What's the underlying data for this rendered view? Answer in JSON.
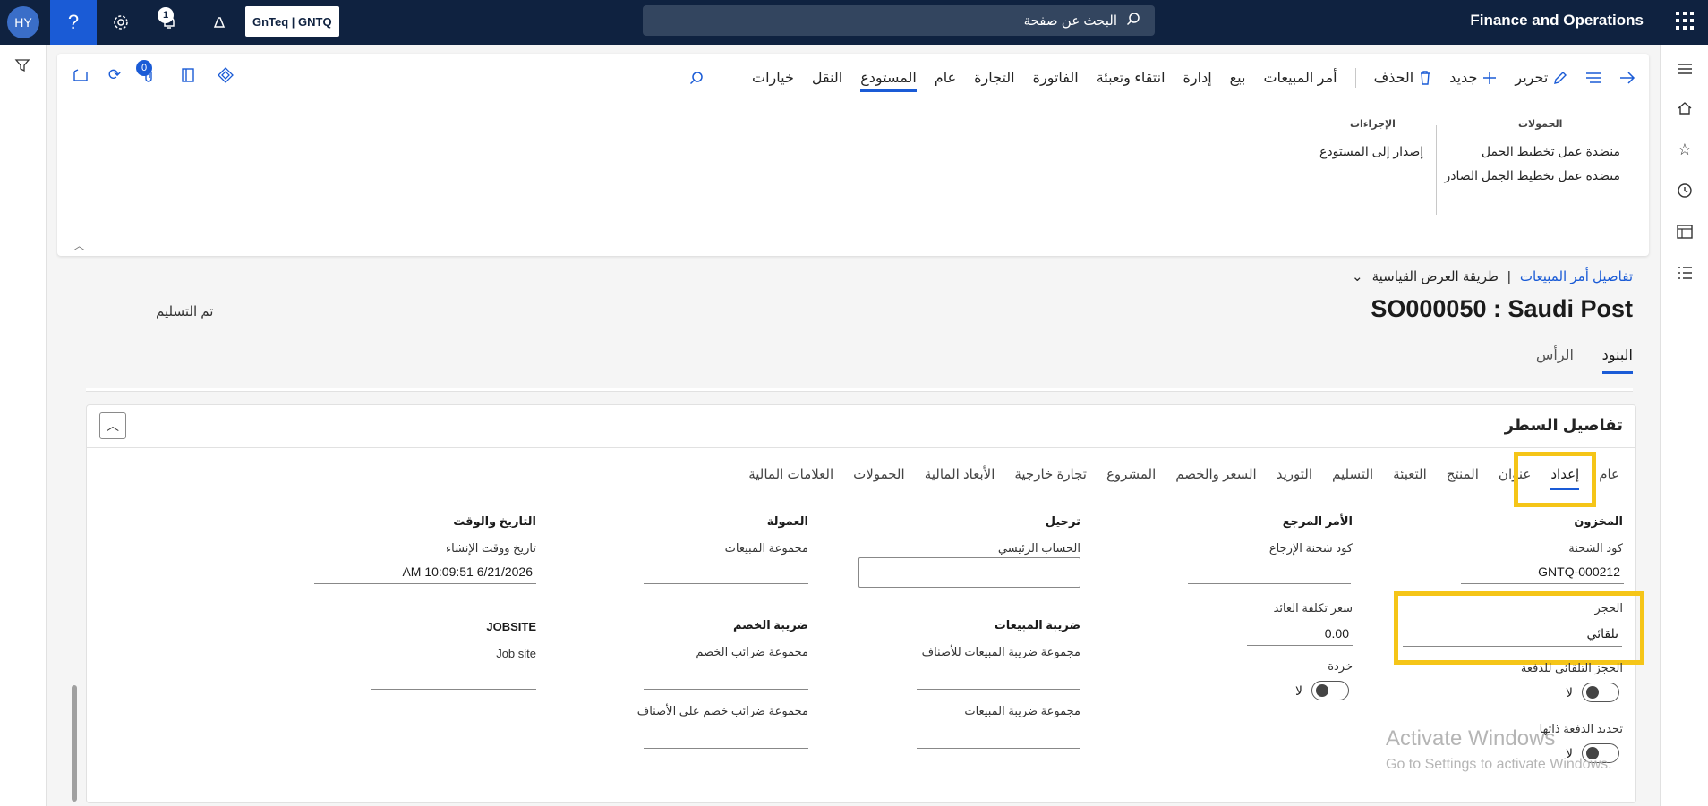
{
  "topbar": {
    "avatar_initials": "HY",
    "notification_count": "1",
    "company": "GnTeq | GNTQ",
    "search_placeholder": "البحث عن صفحة",
    "app_title": "Finance and Operations"
  },
  "action_pane": {
    "menu": {
      "edit": "تحرير",
      "new": "جديد",
      "delete": "الحذف",
      "sales_order": "أمر المبيعات",
      "sell": "بيع",
      "manage": "إدارة",
      "pick_pack": "انتقاء وتعبئة",
      "invoice": "الفاتورة",
      "trade": "التجارة",
      "general": "عام",
      "warehouse": "المستودع",
      "transport": "النقل",
      "options": "خيارات"
    },
    "attachments_count": "0",
    "groups": {
      "loads_title": "الحمولات",
      "load_planning_workbench": "منضدة عمل تخطيط الجمل",
      "outbound_load_planning_workbench": "منضدة عمل تخطيط الجمل الصادر",
      "actions_title": "الإجراءات",
      "release_to_warehouse": "إصدار إلى المستودع"
    }
  },
  "header": {
    "breadcrumb_link": "تفاصيل أمر المبيعات",
    "separator": "|",
    "view": "طريقة العرض القياسية",
    "title": "SO000050 : Saudi Post",
    "status": "تم التسليم",
    "tabs": {
      "lines": "البنود",
      "header": "الرأس"
    }
  },
  "line_details": {
    "title": "تفاصيل السطر",
    "tabs": [
      "عام",
      "إعداد",
      "عنوان",
      "المنتج",
      "التعبئة",
      "التسليم",
      "التوريد",
      "السعر والخصم",
      "المشروع",
      "تجارة خارجية",
      "الأبعاد المالية",
      "الحمولات",
      "العلامات المالية"
    ],
    "active_tab": "إعداد",
    "inventory": {
      "title": "المخزون",
      "batch_code_label": "كود الشحنة",
      "batch_code_value": "GNTQ-000212",
      "reservation_label": "الحجز",
      "reservation_value": "تلقائي",
      "auto_batch_reservation_label": "الحجز التلقائي للدفعة",
      "auto_batch_reservation_value": "لا",
      "batch_self_select_label": "تحديد الدفعة ذاتها",
      "batch_self_select_value": "لا"
    },
    "reference_order": {
      "title": "الأمر المرجع",
      "return_lot_code_label": "كود شحنة الإرجاع",
      "return_cost_price_label": "سعر تكلفة العائد",
      "return_cost_price_value": "0.00",
      "scrap_label": "خردة",
      "scrap_value": "لا"
    },
    "posting": {
      "title": "ترحيل",
      "main_account_label": "الحساب الرئيسي"
    },
    "commission": {
      "title": "العمولة",
      "sales_group_label": "مجموعة المبيعات"
    },
    "datetime": {
      "title": "التاريخ والوقت",
      "created_label": "تاريخ ووقت الإنشاء",
      "created_value": "AM 10:09:51 6/21/2026"
    },
    "sales_tax": {
      "title": "ضريبة المبيعات",
      "item_sales_tax_group_label": "مجموعة ضريبة المبيعات للأصناف",
      "sales_tax_group_label": "مجموعة ضريبة المبيعات"
    },
    "withholding_tax": {
      "title": "ضريبة الخصم",
      "withholding_tax_group_label": "مجموعة ضرائب الخصم",
      "item_withholding_tax_group_label": "مجموعة ضرائب خصم على الأصناف"
    },
    "jobsite": {
      "title": "JOBSITE",
      "job_site_label": "Job site"
    }
  },
  "watermark": {
    "line1": "Activate Windows",
    "line2": "Go to Settings to activate Windows."
  },
  "colors": {
    "topbar": "#0f2240",
    "accent": "#1a5bd6",
    "highlight": "#f5c518"
  }
}
